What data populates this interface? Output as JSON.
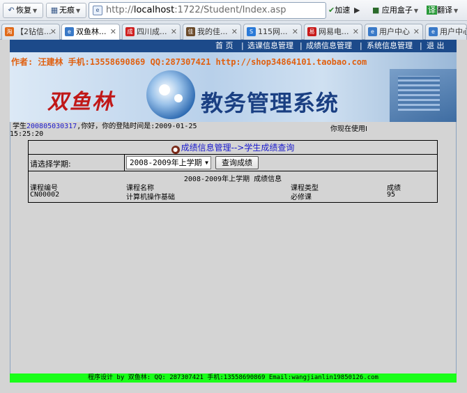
{
  "browser": {
    "back_label": "恢复",
    "history_label": "无痕",
    "address_prefix": "http://",
    "address_host": "localhost",
    "address_rest": ":1722/Student/Index.asp",
    "accelerate_label": "加速",
    "appbox_label": "应用盒子",
    "translate_label": "翻译"
  },
  "tabs": [
    {
      "label": "【2钻信...",
      "icon_color": "#e06a1a",
      "icon_text": "淘"
    },
    {
      "label": "双鱼林...",
      "icon_color": "#3a7ac8",
      "icon_text": "e",
      "active": true
    },
    {
      "label": "四川成...",
      "icon_color": "#d02020",
      "icon_text": "成"
    },
    {
      "label": "我的佳...",
      "icon_color": "#6a4a2a",
      "icon_text": "佳"
    },
    {
      "label": "115网...",
      "icon_color": "#2a7ad8",
      "icon_text": "S"
    },
    {
      "label": "网易电...",
      "icon_color": "#c81a1a",
      "icon_text": "易"
    },
    {
      "label": "用户中心",
      "icon_color": "#3a7ac8",
      "icon_text": "e"
    },
    {
      "label": "用户中心",
      "icon_color": "#3a7ac8",
      "icon_text": "e"
    }
  ],
  "nav": {
    "home": "首 页",
    "course": "选课信息管理",
    "grades": "成绩信息管理",
    "system": "系统信息管理",
    "logout": "退 出",
    "separator": "|"
  },
  "banner": {
    "author_line": "作者: 汪建林  手机:13558690869 QQ:287307421 http://shop34864101.taobao.com",
    "logo_left": "双鱼林",
    "logo_right": "教务管理系统"
  },
  "status": {
    "prefix": "学生",
    "student_id": "200805030317",
    "greeting": ",你好，你的登陆时间是:2009-01-25",
    "time": "15:25:20",
    "using": "你现在使用I"
  },
  "panel": {
    "title": "成绩信息管理-->学生成绩查询",
    "semester_label": "请选择学期:",
    "semester_value": "2008-2009年上学期",
    "query_button": "查询成绩",
    "result_title": "2008-2009年上学期 成绩信息",
    "columns": [
      "课程编号",
      "课程名称",
      "课程类型",
      "成绩"
    ],
    "rows": [
      [
        "CN00002",
        "计算机操作基础",
        "必修课",
        "95"
      ]
    ]
  },
  "footer": {
    "text": "程序设计 by 双鱼林: QQ: 287307421 手机:13558690869 Email:wangjianlin19850126.com"
  }
}
